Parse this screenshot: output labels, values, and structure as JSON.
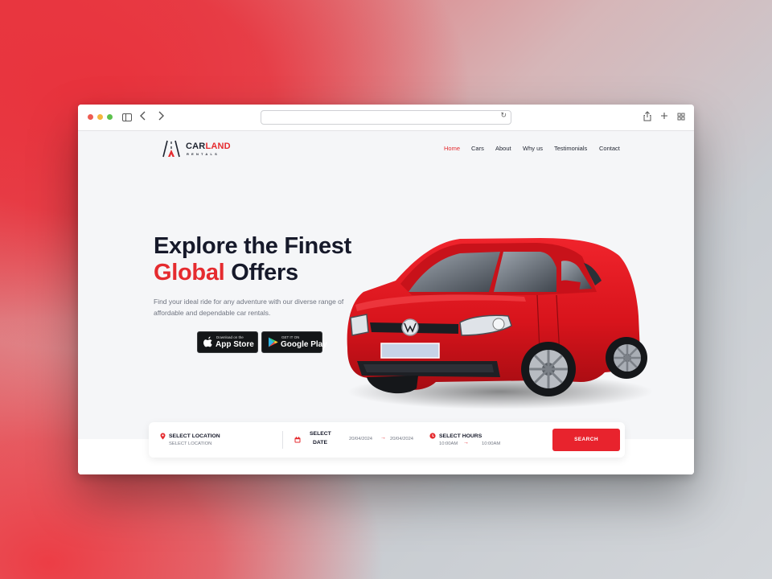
{
  "browser": {
    "url": ""
  },
  "brand": {
    "name_part1": "CAR",
    "name_part2": "LAND",
    "tagline": "RENTALS"
  },
  "nav": {
    "items": [
      "Home",
      "Cars",
      "About",
      "Why us",
      "Testimonials",
      "Contact"
    ],
    "active": "Home"
  },
  "hero": {
    "title_line1": "Explore the Finest",
    "title_accent": "Global",
    "title_rest": " Offers",
    "description": "Find your ideal ride for any adventure with our diverse range of affordable and dependable car rentals."
  },
  "stores": {
    "apple_small": "Download on the",
    "apple_big": "App Store",
    "google_small": "GET IT ON",
    "google_big": "Google Play"
  },
  "booking": {
    "location_label": "SELECT LOCATION",
    "location_sub": "SELECT LOCATION",
    "date_label_1": "SELECT",
    "date_label_2": "DATE",
    "date_from": "20/04/2024",
    "date_to": "20/04/2024",
    "hours_label": "SELECT HOURS",
    "time_from": "10:00AM",
    "time_to": "10:00AM",
    "arrow": "→",
    "search_label": "SEARCH"
  },
  "colors": {
    "accent": "#e52b2f",
    "dark": "#16192a",
    "car_body": "#d8141c"
  },
  "icons": [
    "sidebar-icon",
    "back-icon",
    "forward-icon",
    "reload-icon",
    "share-icon",
    "new-tab-icon",
    "tabs-overview-icon",
    "location-pin-icon",
    "calendar-icon",
    "clock-icon",
    "apple-icon",
    "google-play-icon"
  ]
}
